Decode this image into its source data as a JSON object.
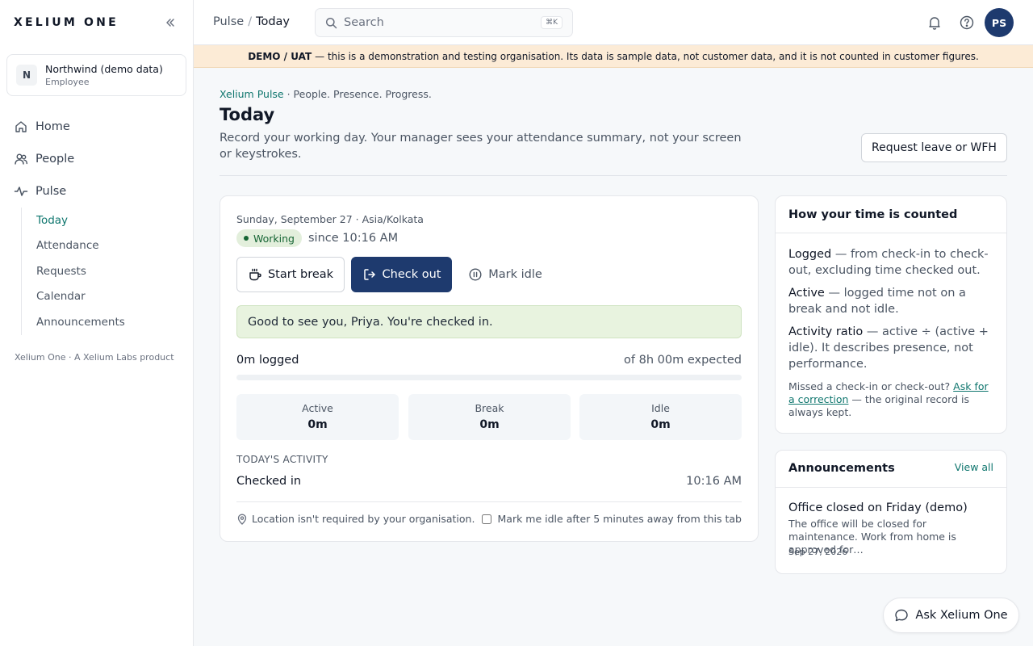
{
  "app": {
    "brand": "XELIUM ONE",
    "footer": "Xelium One · A Xelium Labs product"
  },
  "org": {
    "initial": "N",
    "name": "Northwind (demo data)",
    "role": "Employee"
  },
  "nav": {
    "home": "Home",
    "people": "People",
    "pulse": "Pulse",
    "pulse_items": [
      "Today",
      "Attendance",
      "Requests",
      "Calendar",
      "Announcements"
    ],
    "active_sub": "Today"
  },
  "topbar": {
    "crumb_parent": "Pulse",
    "crumb_sep": "/",
    "crumb_current": "Today",
    "search_placeholder": "Search",
    "search_shortcut": "⌘K",
    "user_initials": "PS"
  },
  "banner": {
    "label": "DEMO / UAT",
    "text": "— this is a demonstration and testing organisation. Its data is sample data, not customer data, and it is not counted in customer figures."
  },
  "header": {
    "eyebrow_brand": "Xelium Pulse",
    "eyebrow_tagline": " · People. Presence. Progress.",
    "title": "Today",
    "description": "Record your working day. Your manager sees your attendance summary, not your screen or keystrokes.",
    "request_button": "Request leave or WFH"
  },
  "today": {
    "date_line": "Sunday, September 27 · Asia/Kolkata",
    "status": "Working",
    "since": "since 10:16 AM",
    "start_break": "Start break",
    "check_out": "Check out",
    "mark_idle": "Mark idle",
    "greeting": "Good to see you, Priya. You're checked in.",
    "logged": "0m logged",
    "expected": "of 8h 00m expected",
    "progress_fraction": 0,
    "stats": [
      {
        "label": "Active",
        "value": "0m"
      },
      {
        "label": "Break",
        "value": "0m"
      },
      {
        "label": "Idle",
        "value": "0m"
      }
    ],
    "activity_heading": "TODAY'S ACTIVITY",
    "activity": [
      {
        "event": "Checked in",
        "time": "10:16 AM"
      }
    ],
    "location_note": "Location isn't required by your organisation.",
    "idle_option": "Mark me idle after 5 minutes away from this tab",
    "idle_option_checked": false
  },
  "info": {
    "title": "How your time is counted",
    "defs": [
      {
        "term": "Logged",
        "text": " — from check-in to check-out, excluding time checked out."
      },
      {
        "term": "Active",
        "text": " — logged time not on a break and not idle."
      },
      {
        "term": "Activity ratio",
        "text": " — active ÷ (active + idle). It describes presence, not performance."
      }
    ],
    "note_prefix": "Missed a check-in or check-out? ",
    "note_link": "Ask for a correction",
    "note_suffix": " — the original record is always kept."
  },
  "announcements": {
    "title": "Announcements",
    "view_all": "View all",
    "item": {
      "title": "Office closed on Friday (demo)",
      "body": "The office will be closed for maintenance. Work from home is approved for…",
      "date": "Sep 27, 2026"
    }
  },
  "assistant": {
    "label": "Ask Xelium One"
  },
  "colors": {
    "primary": "#1e3a6e",
    "accent": "#0f766e",
    "banner": "#fcebd6",
    "success_bg": "#e8f3df"
  }
}
